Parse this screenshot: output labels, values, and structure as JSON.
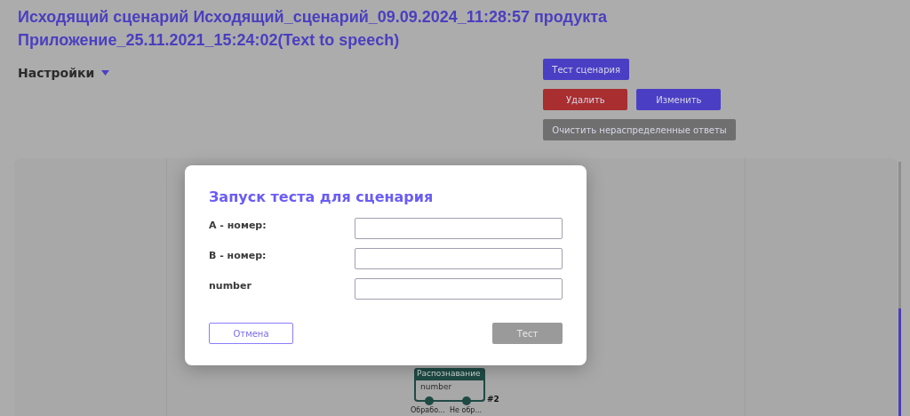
{
  "page": {
    "title": "Исходящий сценарий Исходящий_сценарий_09.09.2024_11:28:57 продукта Приложение_25.11.2021_15:24:02(Text to speech)",
    "settings": {
      "label": "Настройки",
      "expanded": false
    }
  },
  "actions": [
    [
      {
        "label": "Тест сценария",
        "kind": "primary"
      }
    ],
    [
      {
        "label": "Удалить",
        "kind": "danger"
      },
      {
        "label": "Изменить",
        "kind": "primary"
      }
    ],
    [
      {
        "label": "Очистить нераспределенные ответы",
        "kind": "muted"
      }
    ]
  ],
  "canvas": {
    "node": {
      "title": "Распознавание",
      "body": "number",
      "badge": "#2",
      "outputs": [
        "Обрабо...",
        "Не обр..."
      ]
    }
  },
  "dialog": {
    "title": "Запуск теста для сценария",
    "fields": [
      {
        "label": "A - номер:"
      },
      {
        "label": "B - номер:"
      },
      {
        "label": "number"
      }
    ],
    "cancel": "Отмена",
    "submit": {
      "label": "Тест",
      "disabled": true
    }
  }
}
